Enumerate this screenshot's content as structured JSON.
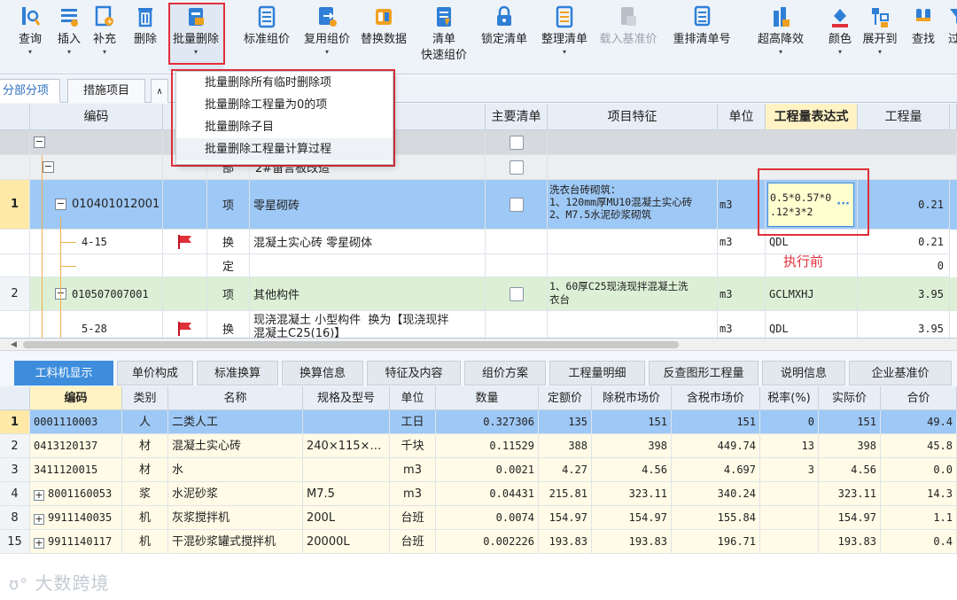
{
  "toolbar": {
    "items": [
      {
        "label": "查询",
        "icon": "query-icon",
        "arrow": true
      },
      {
        "label": "插入",
        "icon": "insert-icon",
        "arrow": true
      },
      {
        "label": "补充",
        "icon": "supplement-icon",
        "arrow": true
      },
      {
        "label": "删除",
        "icon": "delete-icon",
        "arrow": false
      },
      {
        "label": "批量删除",
        "icon": "batch-delete-icon",
        "arrow": true
      },
      {
        "label": "标准组价",
        "icon": "standard-price-icon",
        "arrow": false
      },
      {
        "label": "复用组价",
        "icon": "reuse-price-icon",
        "arrow": true
      },
      {
        "label": "替换数据",
        "icon": "replace-data-icon",
        "arrow": false
      },
      {
        "label": "清单",
        "label2": "快速组价",
        "icon": "quick-price-icon",
        "arrow": false
      },
      {
        "label": "锁定清单",
        "icon": "lock-icon",
        "arrow": false
      },
      {
        "label": "整理清单",
        "icon": "organize-icon",
        "arrow": true
      },
      {
        "label": "载入基准价",
        "icon": "load-base-price-icon",
        "arrow": false,
        "disabled": true
      },
      {
        "label": "重排清单号",
        "icon": "renumber-icon",
        "arrow": false
      },
      {
        "label": "超高降效",
        "icon": "high-efficiency-icon",
        "arrow": true
      },
      {
        "label": "颜色",
        "icon": "color-icon",
        "arrow": true
      },
      {
        "label": "展开到",
        "icon": "expand-to-icon",
        "arrow": true
      },
      {
        "label": "查找",
        "icon": "find-icon",
        "arrow": false
      },
      {
        "label": "过",
        "icon": "filter-icon",
        "arrow": false
      }
    ]
  },
  "tabs": [
    "分部分项",
    "措施项目"
  ],
  "menu": {
    "items": [
      "批量删除所有临时删除项",
      "批量删除工程量为0的项",
      "批量删除子目",
      "批量删除工程量计算过程"
    ]
  },
  "grid": {
    "headers": {
      "code": "编码",
      "main_list": "主要清单",
      "feature": "项目特征",
      "unit": "单位",
      "expr": "工程量表达式",
      "qty": "工程量"
    },
    "rows": [
      {
        "no": "",
        "code": "",
        "type": "",
        "name": "",
        "tree": "minus"
      },
      {
        "no": "",
        "code": "",
        "type": "部",
        "name": "2#留言板改造",
        "tree": "minus"
      },
      {
        "no": "1",
        "code": "010401012001",
        "type": "项",
        "name": "零星砌砖",
        "feature": "洗衣台砖砌筑：\n1、120mm厚MU10混凝土实心砖\n2、M7.5水泥砂浆砌筑",
        "unit": "m3",
        "expr": "0.5*0.57*0\n.12*3*2",
        "qty": "0.21"
      },
      {
        "no": "",
        "code": "4-15",
        "type": "换",
        "name": "混凝土实心砖 零星砌体",
        "unit": "m3",
        "expr": "QDL",
        "qty": "0.21"
      },
      {
        "no": "",
        "code": "",
        "type": "定",
        "name": "",
        "qty": "0"
      },
      {
        "no": "2",
        "code": "010507007001",
        "type": "项",
        "name": "其他构件",
        "feature": "1、60厚C25现浇现拌混凝土洗\n衣台",
        "unit": "m3",
        "expr": "GCLMXHJ",
        "qty": "3.95"
      },
      {
        "no": "",
        "code": "5-28",
        "type": "换",
        "name": "现浇混凝土 小型构件  换为【现浇现拌\n混凝土C25(16)】",
        "unit": "m3",
        "expr": "QDL",
        "qty": "3.95"
      }
    ]
  },
  "annotation": "执行前",
  "lower_tabs": [
    "工料机显示",
    "单价构成",
    "标准换算",
    "换算信息",
    "特征及内容",
    "组价方案",
    "工程量明细",
    "反查图形工程量",
    "说明信息",
    "企业基准价"
  ],
  "lower_grid": {
    "headers": [
      "编码",
      "类别",
      "名称",
      "规格及型号",
      "单位",
      "数量",
      "定额价",
      "除税市场价",
      "含税市场价",
      "税率(%)",
      "实际价",
      "合价"
    ],
    "rows": [
      {
        "no": "1",
        "code": "0001110003",
        "cat": "人",
        "name": "二类人工",
        "spec": "",
        "unit": "工日",
        "qty": "0.327306",
        "base": "135",
        "ex": "151",
        "inc": "151",
        "tax": "0",
        "real": "151",
        "total": "49.4",
        "plus": false
      },
      {
        "no": "2",
        "code": "0413120137",
        "cat": "材",
        "name": "混凝土实心砖",
        "spec": "240×115×…",
        "unit": "千块",
        "qty": "0.11529",
        "base": "388",
        "ex": "398",
        "inc": "449.74",
        "tax": "13",
        "real": "398",
        "total": "45.8",
        "plus": false
      },
      {
        "no": "3",
        "code": "3411120015",
        "cat": "材",
        "name": "水",
        "spec": "",
        "unit": "m3",
        "qty": "0.0021",
        "base": "4.27",
        "ex": "4.56",
        "inc": "4.697",
        "tax": "3",
        "real": "4.56",
        "total": "0.0",
        "plus": false
      },
      {
        "no": "4",
        "code": "8001160053",
        "cat": "浆",
        "name": "水泥砂浆",
        "spec": "M7.5",
        "unit": "m3",
        "qty": "0.04431",
        "base": "215.81",
        "ex": "323.11",
        "inc": "340.24",
        "tax": "",
        "real": "323.11",
        "total": "14.3",
        "plus": true
      },
      {
        "no": "8",
        "code": "9911140035",
        "cat": "机",
        "name": "灰浆搅拌机",
        "spec": "200L",
        "unit": "台班",
        "qty": "0.0074",
        "base": "154.97",
        "ex": "154.97",
        "inc": "155.84",
        "tax": "",
        "real": "154.97",
        "total": "1.1",
        "plus": true
      },
      {
        "no": "15",
        "code": "9911140117",
        "cat": "机",
        "name": "干混砂浆罐式搅拌机",
        "spec": "20000L",
        "unit": "台班",
        "qty": "0.002226",
        "base": "193.83",
        "ex": "193.83",
        "inc": "196.71",
        "tax": "",
        "real": "193.83",
        "total": "0.4",
        "plus": true
      }
    ]
  },
  "watermark": "大数跨境",
  "colors": {
    "selected_row": "#9ec8f5",
    "green_row": "#ddf0d6",
    "accent": "#3d8ddc",
    "highlight": "#e0303a",
    "yellow": "#ffffd0"
  }
}
